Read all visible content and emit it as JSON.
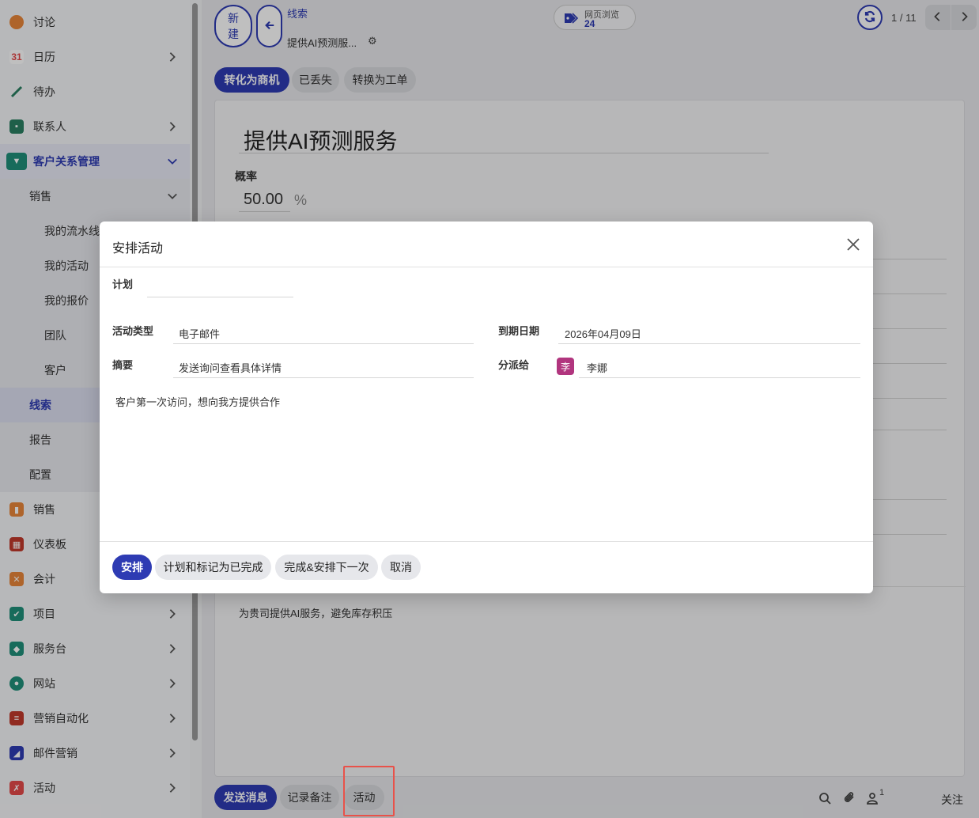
{
  "sidebar": {
    "items": [
      {
        "label": "讨论",
        "icon": "discuss-icon",
        "color": "#e8863a",
        "chevron": false
      },
      {
        "label": "日历",
        "icon": "calendar-icon",
        "color": "#e44a4a",
        "chevron": true
      },
      {
        "label": "待办",
        "icon": "todo-icon",
        "color": "#2a7f62",
        "chevron": false
      },
      {
        "label": "联系人",
        "icon": "contacts-icon",
        "color": "#2a7f62",
        "chevron": true
      },
      {
        "label": "客户关系管理",
        "icon": "crm-icon",
        "color": "#1f8f7a",
        "chevron": true
      },
      {
        "label": "销售",
        "chevron": true
      },
      {
        "label": "我的流水线"
      },
      {
        "label": "我的活动"
      },
      {
        "label": "我的报价"
      },
      {
        "label": "团队"
      },
      {
        "label": "客户"
      },
      {
        "label": "线索"
      },
      {
        "label": "报告"
      },
      {
        "label": "配置"
      },
      {
        "label": "销售",
        "icon": "sales-icon",
        "color": "#e8863a",
        "chevron": false
      },
      {
        "label": "仪表板",
        "icon": "dashboard-icon",
        "color": "#c0392b",
        "chevron": false
      },
      {
        "label": "会计",
        "icon": "accounting-icon",
        "color": "#e8863a",
        "chevron": false
      },
      {
        "label": "项目",
        "icon": "project-icon",
        "color": "#1f8f7a",
        "chevron": true
      },
      {
        "label": "服务台",
        "icon": "helpdesk-icon",
        "color": "#1f8f7a",
        "chevron": true
      },
      {
        "label": "网站",
        "icon": "website-icon",
        "color": "#1f8f7a",
        "chevron": true
      },
      {
        "label": "营销自动化",
        "icon": "marketing-automation-icon",
        "color": "#c0392b",
        "chevron": true
      },
      {
        "label": "邮件营销",
        "icon": "email-marketing-icon",
        "color": "#2e3bb3",
        "chevron": true
      },
      {
        "label": "活动",
        "icon": "events-icon",
        "color": "#e44a4a",
        "chevron": true
      }
    ]
  },
  "topbar": {
    "new_label_line1": "新",
    "new_label_line2": "建",
    "breadcrumb_parent": "线索",
    "breadcrumb_current": "提供AI预测服...",
    "web_views_label": "网页浏览",
    "web_views_count": "24",
    "pager": "1 / 11"
  },
  "actions": {
    "convert_opportunity": "转化为商机",
    "mark_lost": "已丢失",
    "convert_ticket": "转换为工单"
  },
  "lead": {
    "title": "提供AI预测服务",
    "probability_label": "概率",
    "probability_value": "50.00",
    "probability_unit": "%",
    "description": "为贵司提供AI服务，避免库存积压"
  },
  "chatter": {
    "send_message": "发送消息",
    "log_note": "记录备注",
    "activity": "活动",
    "followers_count": "1",
    "follow": "关注"
  },
  "modal": {
    "title": "安排活动",
    "plan_label": "计划",
    "plan_value": "",
    "activity_type_label": "活动类型",
    "activity_type_value": "电子邮件",
    "summary_label": "摘要",
    "summary_value": "发送询问查看具体详情",
    "due_date_label": "到期日期",
    "due_date_value": "2026年04月09日",
    "assigned_label": "分派给",
    "assigned_avatar": "李",
    "assigned_value": "李娜",
    "note": "客户第一次访问，想向我方提供合作",
    "buttons": {
      "schedule": "安排",
      "schedule_mark_done": "计划和标记为已完成",
      "done_schedule_next": "完成&安排下一次",
      "cancel": "取消"
    }
  },
  "colors": {
    "primary": "#2e3bb3",
    "avatar": "#b1357e",
    "highlight": "#e8524a"
  }
}
